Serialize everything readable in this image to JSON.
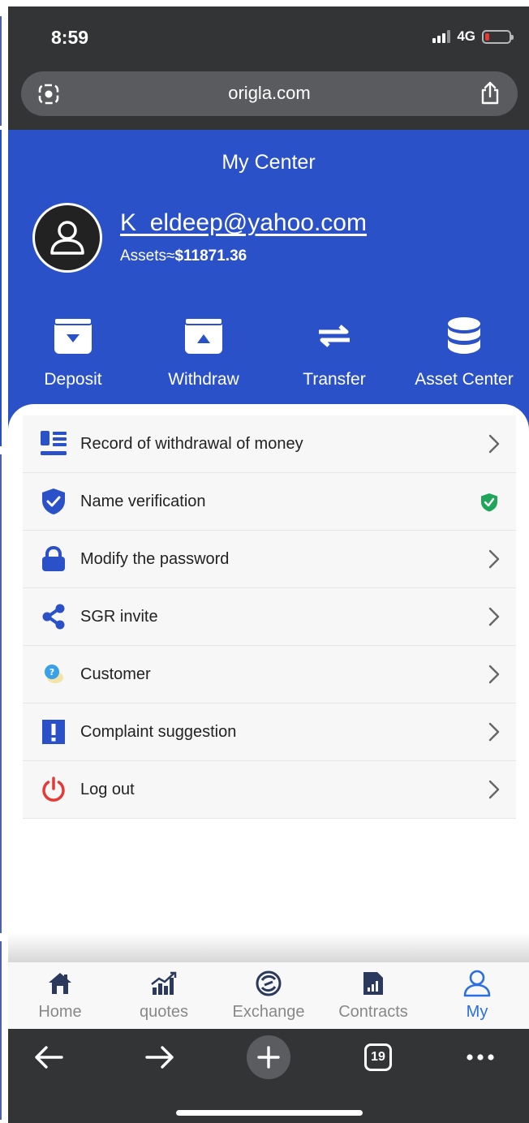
{
  "status_bar": {
    "time": "8:59",
    "network": "4G"
  },
  "browser": {
    "url": "origla.com",
    "tab_count": "19"
  },
  "header": {
    "title": "My Center",
    "email": "K_eldeep@yahoo.com",
    "assets_label": "Assets≈",
    "assets_value": "$11871.36"
  },
  "actions": [
    {
      "label": "Deposit",
      "icon": "deposit-icon"
    },
    {
      "label": "Withdraw",
      "icon": "withdraw-icon"
    },
    {
      "label": "Transfer",
      "icon": "transfer-icon"
    },
    {
      "label": "Asset Center",
      "icon": "database-icon"
    }
  ],
  "menu": [
    {
      "label": "Record of withdrawal of money",
      "icon": "list-icon"
    },
    {
      "label": "Name verification",
      "icon": "shield-check-icon"
    },
    {
      "label": "Modify the password",
      "icon": "lock-icon"
    },
    {
      "label": "SGR invite",
      "icon": "share-icon"
    },
    {
      "label": "Customer",
      "icon": "chat-icon"
    },
    {
      "label": "Complaint suggestion",
      "icon": "alert-icon"
    },
    {
      "label": "Log out",
      "icon": "power-icon"
    }
  ],
  "tabs": [
    {
      "label": "Home",
      "icon": "home-icon"
    },
    {
      "label": "quotes",
      "icon": "chart-icon"
    },
    {
      "label": "Exchange",
      "icon": "exchange-icon"
    },
    {
      "label": "Contracts",
      "icon": "document-chart-icon"
    },
    {
      "label": "My",
      "icon": "user-icon"
    }
  ],
  "colors": {
    "brand_blue": "#2a51c7",
    "active_tab": "#2a6ee0",
    "verified_green": "#1fa65a",
    "logout_red": "#e53935"
  }
}
